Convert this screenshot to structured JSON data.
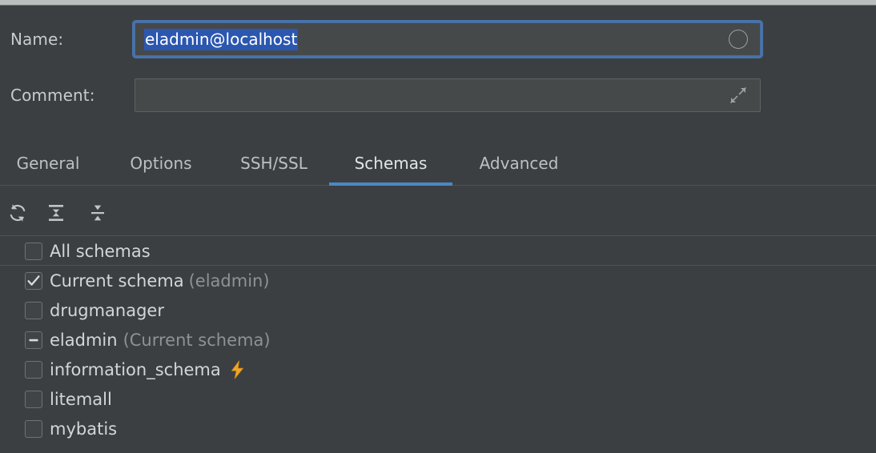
{
  "window": {
    "theme": "darcula",
    "background_color": "#3c3f41",
    "accent_color": "#4a88c7",
    "selection_color": "#2c57b0"
  },
  "form": {
    "name": {
      "label": "Name:",
      "value": "eladmin@localhost",
      "selected": true,
      "focused": true,
      "right_icon": "circle-icon"
    },
    "comment": {
      "label": "Comment:",
      "value": "",
      "placeholder": "",
      "right_icon": "expand-icon"
    }
  },
  "tabs": [
    {
      "label": "General",
      "active": false
    },
    {
      "label": "Options",
      "active": false
    },
    {
      "label": "SSH/SSL",
      "active": false
    },
    {
      "label": "Schemas",
      "active": true
    },
    {
      "label": "Advanced",
      "active": false
    }
  ],
  "toolbar": {
    "buttons": [
      {
        "icon": "refresh-icon",
        "tooltip": "Refresh"
      },
      {
        "icon": "expand-all-icon",
        "tooltip": "Expand All"
      },
      {
        "icon": "collapse-all-icon",
        "tooltip": "Collapse All"
      }
    ]
  },
  "search": {
    "icon": "search-icon",
    "value": "",
    "placeholder": ""
  },
  "schema_list": [
    {
      "label": "All schemas",
      "hint": "",
      "state": "unchecked",
      "badge": "",
      "separator_below": true
    },
    {
      "label": "Current schema",
      "hint": "(eladmin)",
      "state": "checked",
      "badge": "",
      "separator_below": false
    },
    {
      "label": "drugmanager",
      "hint": "",
      "state": "unchecked",
      "badge": "",
      "separator_below": false
    },
    {
      "label": "eladmin",
      "hint": "(Current schema)",
      "state": "indeterminate",
      "badge": "",
      "separator_below": false
    },
    {
      "label": "information_schema",
      "hint": "",
      "state": "unchecked",
      "badge": "lightning-bolt-icon",
      "separator_below": false
    },
    {
      "label": "litemall",
      "hint": "",
      "state": "unchecked",
      "badge": "",
      "separator_below": false
    },
    {
      "label": "mybatis",
      "hint": "",
      "state": "unchecked",
      "badge": "",
      "separator_below": false
    }
  ]
}
